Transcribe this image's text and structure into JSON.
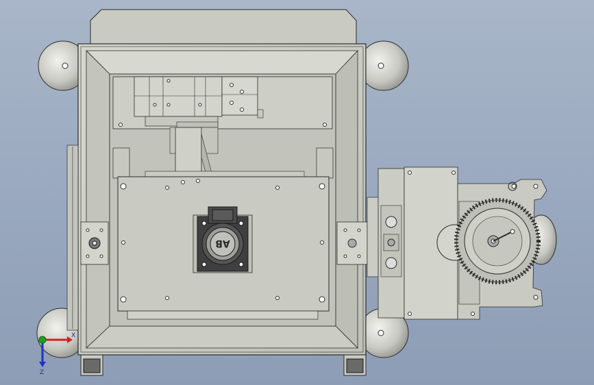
{
  "viewport": {
    "background_top": "#a9b6c9",
    "background_bottom": "#8d9db5"
  },
  "palette": {
    "metal": "#c9cbc2",
    "metal_dark": "#b3b5ac",
    "metal_light": "#dcddd6",
    "edge": "#2b2b2b",
    "hole": "#3a3a3a",
    "triad_x": "#d42020",
    "triad_y": "#20a020",
    "triad_z": "#2030c8"
  },
  "triad": {
    "axis_z_label": "Z",
    "axis_x_label": "X"
  },
  "motor_nameplate": {
    "logo_text": "AB"
  }
}
